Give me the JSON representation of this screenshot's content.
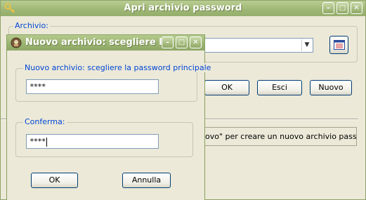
{
  "background_window": {
    "title": "Apri archivio password",
    "group_label": "Archivio:",
    "combo_value": "",
    "buttons": {
      "ok": "OK",
      "exit": "Esci",
      "new": "Nuovo"
    },
    "status_text": "ovo\" per creare un nuovo archivio passwor"
  },
  "dialog": {
    "title": "Nuovo archivio: scegliere l...",
    "group1_label": "Nuovo archivio: scegliere la password principale",
    "password_value": "****",
    "group2_label": "Conferma:",
    "confirm_value": "****",
    "buttons": {
      "ok": "OK",
      "cancel": "Annulla"
    }
  },
  "titlebar_buttons": {
    "minimize": "–",
    "maximize": "□",
    "close": "✕"
  },
  "colors": {
    "titlebar": "#9fb876",
    "group_label": "#0046d5",
    "window_bg": "#ece9d8"
  }
}
